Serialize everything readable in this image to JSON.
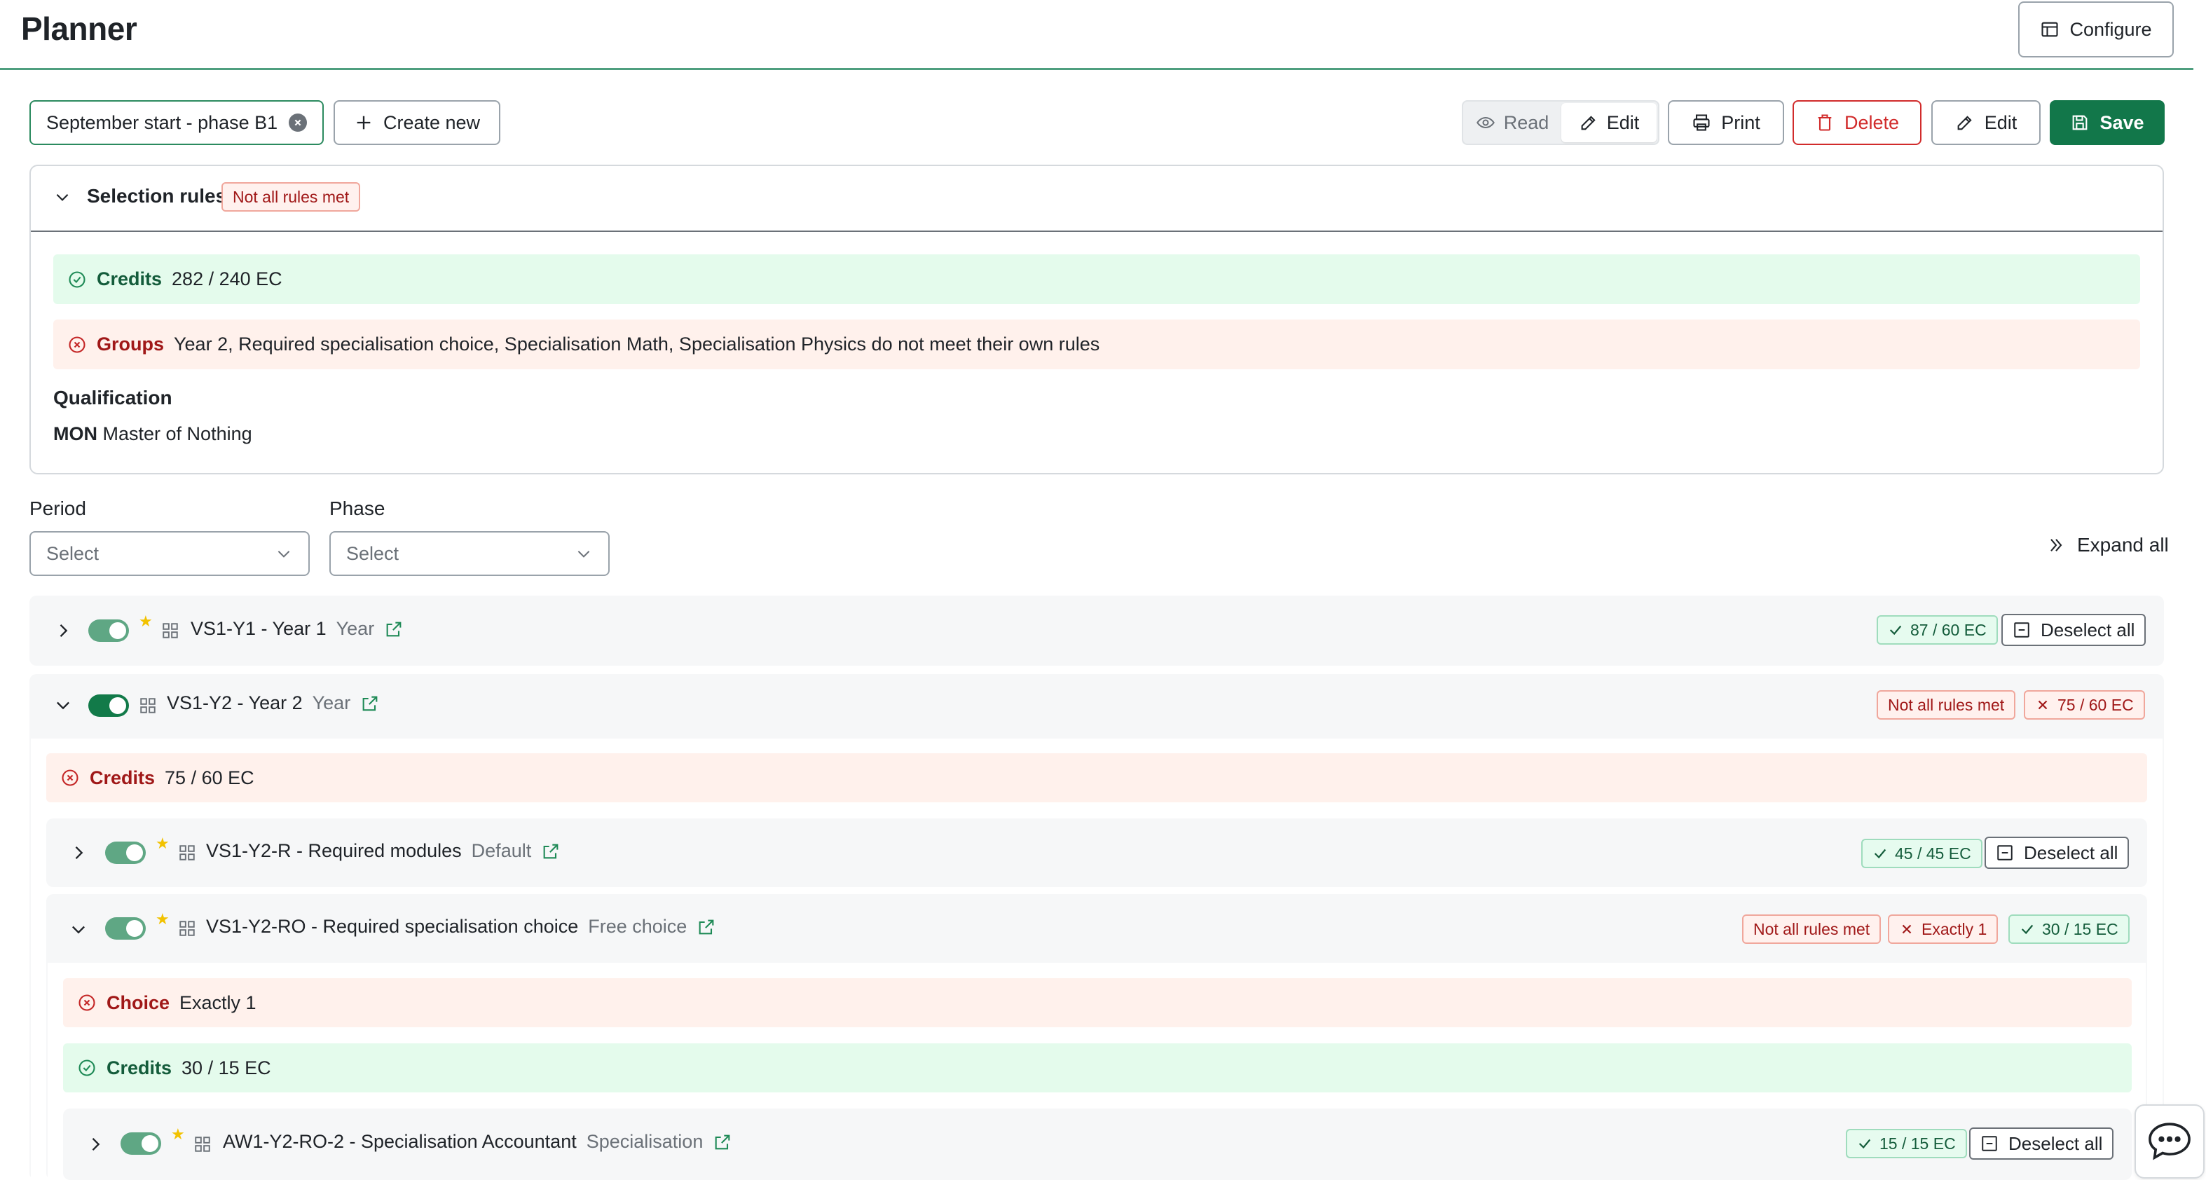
{
  "app": {
    "title": "Planner",
    "configure_label": "Configure"
  },
  "toolbar": {
    "scenario_value": "September start - phase B1",
    "create_label": "Create new",
    "mode_read": "Read",
    "mode_edit": "Edit",
    "print_label": "Print",
    "delete_label": "Delete",
    "edit_label": "Edit",
    "save_label": "Save"
  },
  "rules": {
    "title": "Selection rules",
    "status_badge": "Not all rules met",
    "credits_label": "Credits",
    "credits_value": "282 / 240 EC",
    "groups_label": "Groups",
    "groups_value": "Year 2, Required specialisation choice, Specialisation Math, Specialisation Physics do not meet their own rules",
    "qualification_title": "Qualification",
    "qualification_code": "MON",
    "qualification_name": "Master of Nothing"
  },
  "filters": {
    "period_label": "Period",
    "period_placeholder": "Select",
    "phase_label": "Phase",
    "phase_placeholder": "Select",
    "expand_all": "Expand all"
  },
  "tree": {
    "deselect_label": "Deselect all",
    "year1": {
      "code": "VS1-Y1 - Year 1",
      "type": "Year",
      "credits": "87 / 60 EC"
    },
    "year2": {
      "code": "VS1-Y2 - Year 2",
      "type": "Year",
      "rules_badge": "Not all rules met",
      "credits": "75 / 60 EC",
      "credits_label": "Credits",
      "credits_value": "75 / 60 EC"
    },
    "required": {
      "code": "VS1-Y2-R - Required modules",
      "type": "Default",
      "credits": "45 / 45 EC"
    },
    "spec_choice": {
      "code": "VS1-Y2-RO - Required specialisation choice",
      "type": "Free choice",
      "rules_badge": "Not all rules met",
      "choice_badge": "Exactly 1",
      "credits": "30 / 15 EC",
      "choice_label": "Choice",
      "choice_value": "Exactly 1",
      "credits_label": "Credits",
      "credits_value": "30 / 15 EC"
    },
    "accountant": {
      "code": "AW1-Y2-RO-2 - Specialisation Accountant",
      "type": "Specialisation",
      "credits": "15 / 15 EC"
    }
  },
  "colors": {
    "primary": "#12774a",
    "danger": "#d12b2b",
    "success_bg": "#e4fbec",
    "danger_bg": "#fff1ec"
  }
}
